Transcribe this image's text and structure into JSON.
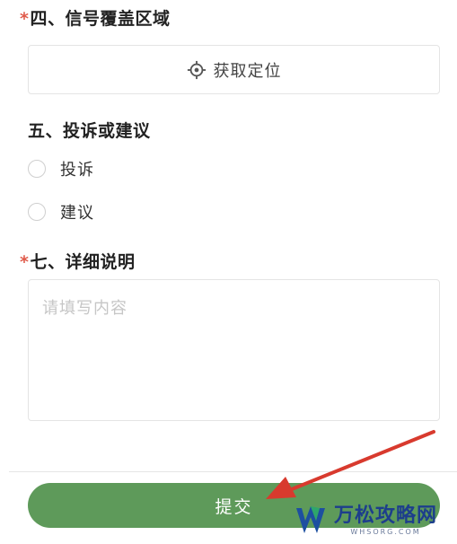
{
  "sections": {
    "coverage": {
      "star": "*",
      "title": "四、信号覆盖区域",
      "locate_button": {
        "icon": "crosshair-icon",
        "label": "获取定位"
      }
    },
    "complaint": {
      "title": "五、投诉或建议",
      "options": [
        {
          "label": "投诉",
          "selected": false
        },
        {
          "label": "建议",
          "selected": false
        }
      ]
    },
    "details": {
      "star": "*",
      "title": "七、详细说明",
      "placeholder": "请填写内容",
      "value": ""
    }
  },
  "footer": {
    "submit_label": "提交"
  },
  "watermark": {
    "title": "万松攻略网",
    "subtitle": "WHSORG.COM"
  },
  "colors": {
    "accent": "#5e9a5a",
    "required": "#e05a4a",
    "annotation_arrow": "#d83a2e"
  }
}
